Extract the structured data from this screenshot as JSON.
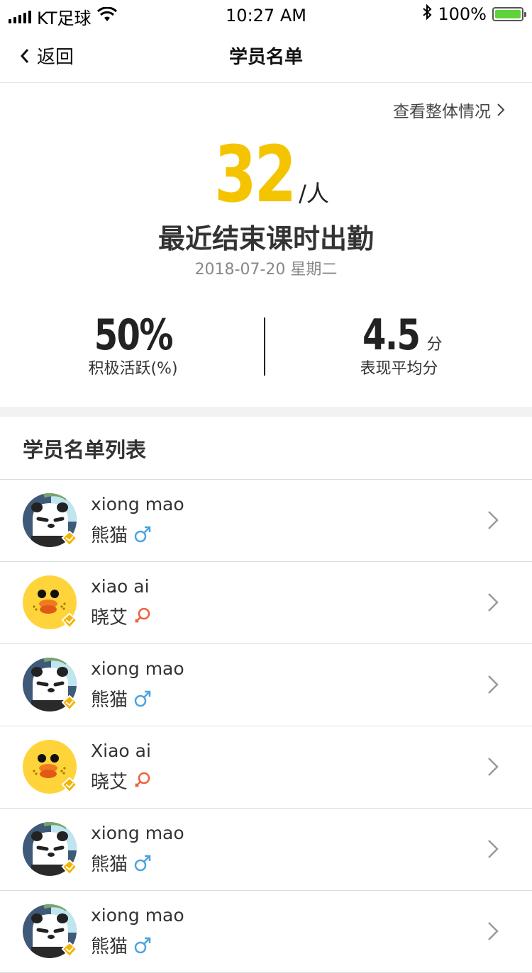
{
  "status_bar": {
    "carrier": "KT足球",
    "time": "10:27 AM",
    "battery": "100%"
  },
  "nav": {
    "back_label": "返回",
    "title": "学员名单"
  },
  "summary": {
    "overall_link": "查看整体情况",
    "count": "32",
    "count_unit": "/人",
    "subtitle": "最近结束课时出勤",
    "date": "2018-07-20 星期二",
    "active_value": "50%",
    "active_label": "积极活跃(%)",
    "score_value": "4.5",
    "score_unit": "分",
    "score_label": "表现平均分"
  },
  "list_title": "学员名单列表",
  "students": [
    {
      "name_en": "xiong mao",
      "name_cn": "熊猫",
      "gender": "male",
      "avatar": "panda-avatar"
    },
    {
      "name_en": "xiao ai",
      "name_cn": "晓艾",
      "gender": "female",
      "avatar": "chick-avatar"
    },
    {
      "name_en": "xiong mao",
      "name_cn": "熊猫",
      "gender": "male",
      "avatar": "panda-avatar"
    },
    {
      "name_en": "Xiao ai",
      "name_cn": "晓艾",
      "gender": "female",
      "avatar": "chick-avatar"
    },
    {
      "name_en": "xiong mao",
      "name_cn": "熊猫",
      "gender": "male",
      "avatar": "panda-avatar"
    },
    {
      "name_en": "xiong mao",
      "name_cn": "熊猫",
      "gender": "male",
      "avatar": "panda-avatar"
    }
  ],
  "colors": {
    "accent": "#f5c400",
    "male": "#4aa3e0",
    "female": "#f0603a",
    "battery": "#5fd33a"
  }
}
